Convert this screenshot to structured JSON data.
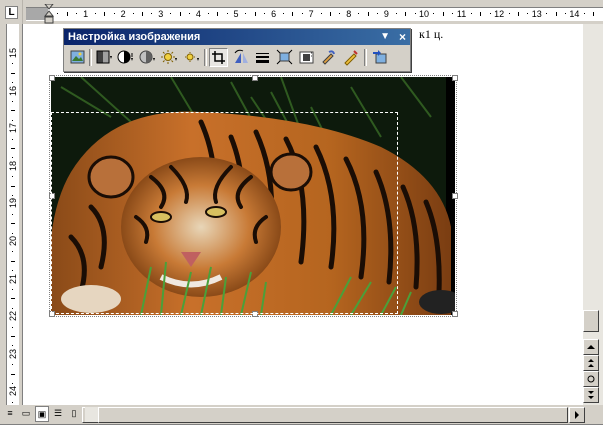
{
  "toolbar": {
    "title": "Настройка изображения",
    "buttons": [
      {
        "name": "insert-picture-button"
      },
      {
        "name": "color-button"
      },
      {
        "name": "more-contrast-button"
      },
      {
        "name": "less-contrast-button"
      },
      {
        "name": "more-brightness-button"
      },
      {
        "name": "less-brightness-button"
      },
      {
        "name": "crop-button",
        "active": true
      },
      {
        "name": "rotate-left-button"
      },
      {
        "name": "line-style-button"
      },
      {
        "name": "compress-pictures-button"
      },
      {
        "name": "text-wrapping-button"
      },
      {
        "name": "format-picture-button"
      },
      {
        "name": "set-transparent-color-button"
      },
      {
        "name": "reset-picture-button"
      }
    ]
  },
  "ruler": {
    "tab_stop_label": "L",
    "horizontal_numbers": [
      "1",
      "2",
      "3",
      "4",
      "5",
      "6",
      "7",
      "8",
      "9",
      "10",
      "11",
      "12",
      "13",
      "14"
    ],
    "vertical_numbers": [
      "15",
      "16",
      "17",
      "18",
      "19",
      "20",
      "21",
      "22",
      "23",
      "24"
    ]
  },
  "document": {
    "text_fragment": "к1 ц."
  },
  "colors": {
    "titlebar": "#0a246a",
    "face": "#d4d0c8",
    "page": "#ffffff"
  }
}
